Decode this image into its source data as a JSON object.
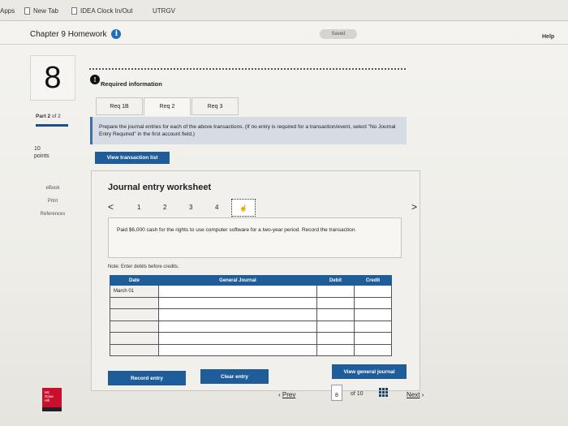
{
  "bookmarks": [
    {
      "label": "Apps"
    },
    {
      "label": "New Tab"
    },
    {
      "label": "IDEA Clock In/Out"
    },
    {
      "label": "UTRGV"
    }
  ],
  "header": {
    "title": "Chapter 9 Homework",
    "saved": "Saved",
    "help": "Help"
  },
  "question": {
    "number": "8",
    "part_prefix": "Part",
    "part_num": "2",
    "part_suffix": "of 2",
    "points_value": "10",
    "points_label": "points"
  },
  "side_links": [
    "eBook",
    "Print",
    "References"
  ],
  "required_info": "Required information",
  "tabs": [
    {
      "label": "Req 1B",
      "active": false
    },
    {
      "label": "Req 2",
      "active": true
    },
    {
      "label": "Req 3",
      "active": false
    }
  ],
  "instructions": "Prepare the journal entries for each of the above transactions. (If no entry is required for a transaction/event, select \"No Journal Entry Required\" in the first account field.)",
  "view_transaction_list": "View transaction list",
  "worksheet": {
    "title": "Journal entry worksheet",
    "nav": [
      "1",
      "2",
      "3",
      "4"
    ],
    "description": "Paid $6,000 cash for the rights to use computer software for a two-year period. Record the transaction.",
    "note": "Note: Enter debits before credits.",
    "columns": {
      "date": "Date",
      "journal": "General Journal",
      "debit": "Debit",
      "credit": "Credit"
    },
    "rows": [
      {
        "date": "March 01"
      },
      {
        "date": ""
      },
      {
        "date": ""
      },
      {
        "date": ""
      },
      {
        "date": ""
      },
      {
        "date": ""
      }
    ],
    "record_entry": "Record entry",
    "clear_entry": "Clear entry",
    "view_general_journal": "View general journal"
  },
  "footer": {
    "logo_lines": [
      "Mc",
      "Graw",
      "Hill"
    ],
    "prev": "Prev",
    "page": "8",
    "of": "of 10",
    "next": "Next"
  }
}
